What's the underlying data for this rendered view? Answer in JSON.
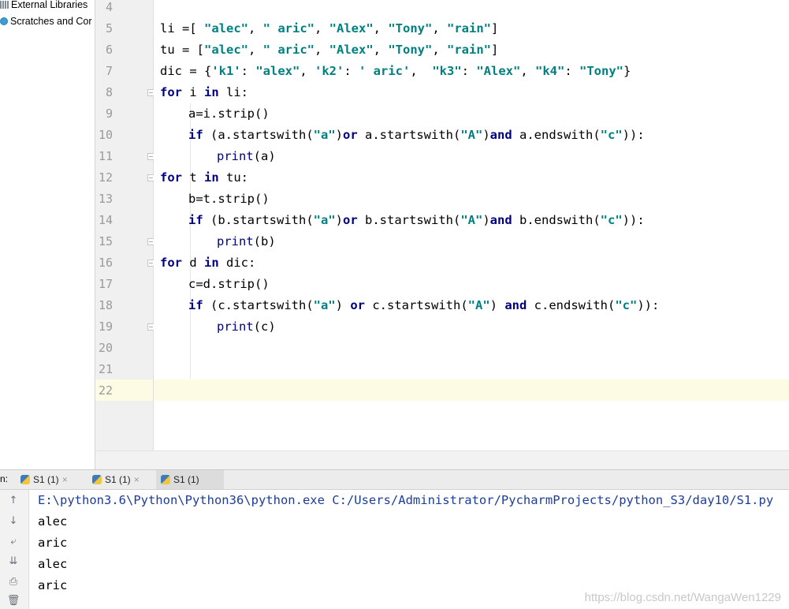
{
  "project": {
    "items": [
      {
        "label": "External Libraries",
        "icon": "library-icon"
      },
      {
        "label": "Scratches and Cor",
        "icon": "scratch-icon"
      }
    ]
  },
  "editor": {
    "line_numbers": [
      "4",
      "5",
      "6",
      "7",
      "8",
      "9",
      "10",
      "11",
      "12",
      "13",
      "14",
      "15",
      "16",
      "17",
      "18",
      "19",
      "20",
      "21",
      "22"
    ],
    "current_line": "22",
    "lines": [
      {
        "ln": 5,
        "indent": 0,
        "tokens": [
          {
            "t": "li =[ "
          },
          {
            "t": "\"alec\"",
            "s": "str"
          },
          {
            "t": ", "
          },
          {
            "t": "\" aric\"",
            "s": "str"
          },
          {
            "t": ", "
          },
          {
            "t": "\"Alex\"",
            "s": "str"
          },
          {
            "t": ", "
          },
          {
            "t": "\"Tony\"",
            "s": "str"
          },
          {
            "t": ", "
          },
          {
            "t": "\"rain\"",
            "s": "str"
          },
          {
            "t": "]"
          }
        ]
      },
      {
        "ln": 6,
        "indent": 0,
        "tokens": [
          {
            "t": "tu = ["
          },
          {
            "t": "\"alec\"",
            "s": "str"
          },
          {
            "t": ", "
          },
          {
            "t": "\" aric\"",
            "s": "str"
          },
          {
            "t": ", "
          },
          {
            "t": "\"Alex\"",
            "s": "str"
          },
          {
            "t": ", "
          },
          {
            "t": "\"Tony\"",
            "s": "str"
          },
          {
            "t": ", "
          },
          {
            "t": "\"rain\"",
            "s": "str"
          },
          {
            "t": "]"
          }
        ]
      },
      {
        "ln": 7,
        "indent": 0,
        "tokens": [
          {
            "t": "dic = {"
          },
          {
            "t": "'k1'",
            "s": "str"
          },
          {
            "t": ": "
          },
          {
            "t": "\"alex\"",
            "s": "str"
          },
          {
            "t": ", "
          },
          {
            "t": "'k2'",
            "s": "str"
          },
          {
            "t": ": "
          },
          {
            "t": "' aric'",
            "s": "str"
          },
          {
            "t": ",  "
          },
          {
            "t": "\"k3\"",
            "s": "str"
          },
          {
            "t": ": "
          },
          {
            "t": "\"Alex\"",
            "s": "str"
          },
          {
            "t": ", "
          },
          {
            "t": "\"k4\"",
            "s": "str"
          },
          {
            "t": ": "
          },
          {
            "t": "\"Tony\"",
            "s": "str"
          },
          {
            "t": "}"
          }
        ]
      },
      {
        "ln": 8,
        "indent": 0,
        "tokens": [
          {
            "t": "for",
            "s": "kw"
          },
          {
            "t": " i "
          },
          {
            "t": "in",
            "s": "kw"
          },
          {
            "t": " li:"
          }
        ]
      },
      {
        "ln": 9,
        "indent": 1,
        "tokens": [
          {
            "t": "a=i.strip()"
          }
        ]
      },
      {
        "ln": 10,
        "indent": 1,
        "tokens": [
          {
            "t": "if",
            "s": "kw"
          },
          {
            "t": " (a.startswith("
          },
          {
            "t": "\"a\"",
            "s": "str"
          },
          {
            "t": ")"
          },
          {
            "t": "or",
            "s": "kw"
          },
          {
            "t": " a.startswith("
          },
          {
            "t": "\"A\"",
            "s": "str"
          },
          {
            "t": ")"
          },
          {
            "t": "and",
            "s": "kw"
          },
          {
            "t": " a.endswith("
          },
          {
            "t": "\"c\"",
            "s": "str"
          },
          {
            "t": ")):"
          }
        ]
      },
      {
        "ln": 11,
        "indent": 2,
        "tokens": [
          {
            "t": "print",
            "s": "bi"
          },
          {
            "t": "(a)"
          }
        ]
      },
      {
        "ln": 12,
        "indent": 0,
        "tokens": [
          {
            "t": "for",
            "s": "kw"
          },
          {
            "t": " t "
          },
          {
            "t": "in",
            "s": "kw"
          },
          {
            "t": " tu:"
          }
        ]
      },
      {
        "ln": 13,
        "indent": 1,
        "tokens": [
          {
            "t": "b=t.strip()"
          }
        ]
      },
      {
        "ln": 14,
        "indent": 1,
        "tokens": [
          {
            "t": "if",
            "s": "kw"
          },
          {
            "t": " (b.startswith("
          },
          {
            "t": "\"a\"",
            "s": "str"
          },
          {
            "t": ")"
          },
          {
            "t": "or",
            "s": "kw"
          },
          {
            "t": " b.startswith("
          },
          {
            "t": "\"A\"",
            "s": "str"
          },
          {
            "t": ")"
          },
          {
            "t": "and",
            "s": "kw"
          },
          {
            "t": " b.endswith("
          },
          {
            "t": "\"c\"",
            "s": "str"
          },
          {
            "t": ")):"
          }
        ]
      },
      {
        "ln": 15,
        "indent": 2,
        "tokens": [
          {
            "t": "print",
            "s": "bi"
          },
          {
            "t": "(b)"
          }
        ]
      },
      {
        "ln": 16,
        "indent": 0,
        "tokens": [
          {
            "t": "for",
            "s": "kw"
          },
          {
            "t": " d "
          },
          {
            "t": "in",
            "s": "kw"
          },
          {
            "t": " dic:"
          }
        ]
      },
      {
        "ln": 17,
        "indent": 1,
        "tokens": [
          {
            "t": "c=d.strip()"
          }
        ]
      },
      {
        "ln": 18,
        "indent": 1,
        "tokens": [
          {
            "t": "if",
            "s": "kw"
          },
          {
            "t": " (c.startswith("
          },
          {
            "t": "\"a\"",
            "s": "str"
          },
          {
            "t": ") "
          },
          {
            "t": "or",
            "s": "kw"
          },
          {
            "t": " c.startswith("
          },
          {
            "t": "\"A\"",
            "s": "str"
          },
          {
            "t": ") "
          },
          {
            "t": "and",
            "s": "kw"
          },
          {
            "t": " c.endswith("
          },
          {
            "t": "\"c\"",
            "s": "str"
          },
          {
            "t": ")):"
          }
        ]
      },
      {
        "ln": 19,
        "indent": 2,
        "tokens": [
          {
            "t": "print",
            "s": "bi"
          },
          {
            "t": "(c)"
          }
        ]
      }
    ]
  },
  "run": {
    "label": "n:",
    "tabs": [
      {
        "label": "S1 (1)",
        "active": false
      },
      {
        "label": "S1 (1)",
        "active": false
      },
      {
        "label": "S1 (1)",
        "active": true
      }
    ],
    "close_glyph": "×"
  },
  "console": {
    "command": "E:\\python3.6\\Python\\Python36\\python.exe C:/Users/Administrator/PycharmProjects/python_S3/day10/S1.py",
    "output": [
      "alec",
      "aric",
      "alec",
      "aric"
    ],
    "toolbar": [
      {
        "name": "rerun-up-icon",
        "glyph": "↑"
      },
      {
        "name": "scroll-down-icon",
        "glyph": "↓"
      },
      {
        "name": "soft-wrap-icon",
        "glyph": "⤶"
      },
      {
        "name": "scroll-to-end-icon",
        "glyph": "⇊"
      },
      {
        "name": "print-icon",
        "glyph": "⎙"
      },
      {
        "name": "trash-icon",
        "glyph": "🗑"
      }
    ]
  },
  "watermark": "https://blog.csdn.net/WangaWen1229"
}
